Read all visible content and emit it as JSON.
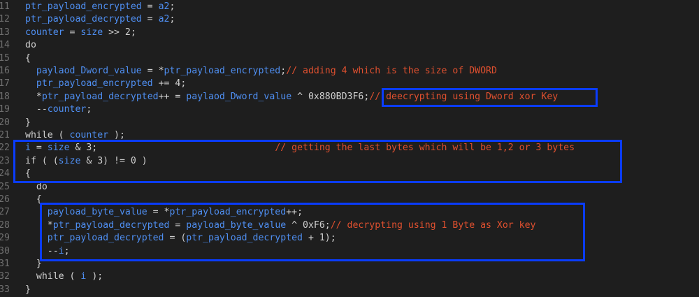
{
  "line_numbers": [
    "11",
    "12",
    "13",
    "14",
    "15",
    "16",
    "17",
    "18",
    "19",
    "20",
    "21",
    "22",
    "23",
    "24",
    "25",
    "26",
    "27",
    "28",
    "29",
    "30",
    "31",
    "32",
    "33"
  ],
  "lines": [
    {
      "indent": "",
      "parts": [
        {
          "t": "ptr_payload_encrypted",
          "c": "var"
        },
        {
          "t": " = ",
          "c": "op"
        },
        {
          "t": "a2",
          "c": "var"
        },
        {
          "t": ";",
          "c": "op"
        }
      ]
    },
    {
      "indent": "",
      "parts": [
        {
          "t": "ptr_payload_decrypted",
          "c": "var"
        },
        {
          "t": " = ",
          "c": "op"
        },
        {
          "t": "a2",
          "c": "var"
        },
        {
          "t": ";",
          "c": "op"
        }
      ]
    },
    {
      "indent": "",
      "parts": [
        {
          "t": "counter",
          "c": "var"
        },
        {
          "t": " = ",
          "c": "op"
        },
        {
          "t": "size",
          "c": "var"
        },
        {
          "t": " >> 2;",
          "c": "op"
        }
      ]
    },
    {
      "indent": "",
      "parts": [
        {
          "t": "do",
          "c": "kw"
        }
      ]
    },
    {
      "indent": "",
      "parts": [
        {
          "t": "{",
          "c": "op"
        }
      ]
    },
    {
      "indent": "  ",
      "parts": [
        {
          "t": "paylaod_Dword_value",
          "c": "var"
        },
        {
          "t": " = *",
          "c": "op"
        },
        {
          "t": "ptr_payload_encrypted",
          "c": "var"
        },
        {
          "t": ";",
          "c": "op"
        },
        {
          "t": "// adding 4 which is the size of DWORD",
          "c": "cmt"
        }
      ]
    },
    {
      "indent": "  ",
      "parts": [
        {
          "t": "ptr_payload_encrypted",
          "c": "var"
        },
        {
          "t": " += 4;",
          "c": "op"
        }
      ]
    },
    {
      "indent": "  ",
      "parts": [
        {
          "t": "*",
          "c": "op"
        },
        {
          "t": "ptr_payload_decrypted",
          "c": "var"
        },
        {
          "t": "++ = ",
          "c": "op"
        },
        {
          "t": "paylaod_Dword_value",
          "c": "var"
        },
        {
          "t": " ^ 0x880BD3F6;",
          "c": "op"
        },
        {
          "t": "// deecrypting using Dword xor Key",
          "c": "cmt"
        }
      ]
    },
    {
      "indent": "  ",
      "parts": [
        {
          "t": "--",
          "c": "op"
        },
        {
          "t": "counter",
          "c": "var"
        },
        {
          "t": ";",
          "c": "op"
        }
      ]
    },
    {
      "indent": "",
      "parts": [
        {
          "t": "}",
          "c": "op"
        }
      ]
    },
    {
      "indent": "",
      "parts": [
        {
          "t": "while ( ",
          "c": "kw"
        },
        {
          "t": "counter",
          "c": "var"
        },
        {
          "t": " );",
          "c": "op"
        }
      ]
    },
    {
      "indent": "",
      "parts": [
        {
          "t": "i",
          "c": "var"
        },
        {
          "t": " = ",
          "c": "op"
        },
        {
          "t": "size",
          "c": "var"
        },
        {
          "t": " & 3;                                ",
          "c": "op"
        },
        {
          "t": "// getting the last bytes which will be 1,2 or 3 bytes",
          "c": "cmt"
        }
      ]
    },
    {
      "indent": "",
      "parts": [
        {
          "t": "if ( (",
          "c": "kw"
        },
        {
          "t": "size",
          "c": "var"
        },
        {
          "t": " & 3) != 0 )",
          "c": "op"
        }
      ]
    },
    {
      "indent": "",
      "parts": [
        {
          "t": "{",
          "c": "op"
        }
      ]
    },
    {
      "indent": "  ",
      "parts": [
        {
          "t": "do",
          "c": "kw"
        }
      ]
    },
    {
      "indent": "  ",
      "parts": [
        {
          "t": "{",
          "c": "op"
        }
      ]
    },
    {
      "indent": "    ",
      "parts": [
        {
          "t": "payload_byte_value",
          "c": "var"
        },
        {
          "t": " = *",
          "c": "op"
        },
        {
          "t": "ptr_payload_encrypted",
          "c": "var"
        },
        {
          "t": "++;",
          "c": "op"
        }
      ]
    },
    {
      "indent": "    ",
      "parts": [
        {
          "t": "*",
          "c": "op"
        },
        {
          "t": "ptr_payload_decrypted",
          "c": "var"
        },
        {
          "t": " = ",
          "c": "op"
        },
        {
          "t": "payload_byte_value",
          "c": "var"
        },
        {
          "t": " ^ 0xF6;",
          "c": "op"
        },
        {
          "t": "// decrypting using 1 Byte as Xor key",
          "c": "cmt"
        }
      ]
    },
    {
      "indent": "    ",
      "parts": [
        {
          "t": "ptr_payload_decrypted",
          "c": "var"
        },
        {
          "t": " = (",
          "c": "op"
        },
        {
          "t": "ptr_payload_decrypted",
          "c": "var"
        },
        {
          "t": " + 1);",
          "c": "op"
        }
      ]
    },
    {
      "indent": "    ",
      "parts": [
        {
          "t": "--",
          "c": "op"
        },
        {
          "t": "i",
          "c": "var"
        },
        {
          "t": ";",
          "c": "op"
        }
      ]
    },
    {
      "indent": "  ",
      "parts": [
        {
          "t": "}",
          "c": "op"
        }
      ]
    },
    {
      "indent": "  ",
      "parts": [
        {
          "t": "while ( ",
          "c": "kw"
        },
        {
          "t": "i",
          "c": "var"
        },
        {
          "t": " );",
          "c": "op"
        }
      ]
    },
    {
      "indent": "",
      "parts": [
        {
          "t": "}",
          "c": "op"
        }
      ]
    }
  ],
  "colors": {
    "background": "#1e1e1e",
    "identifier": "#4f8ff2",
    "plain_text": "#d0d0d0",
    "comment": "#e0502f",
    "line_number": "#6f6f6f",
    "highlight_box": "#0a3cff"
  }
}
